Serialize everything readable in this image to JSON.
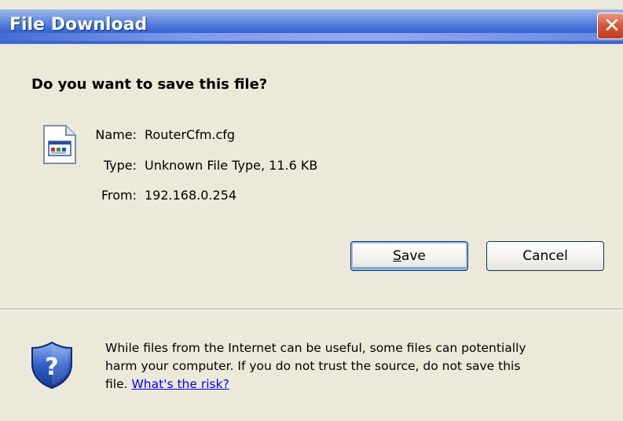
{
  "window": {
    "title": "File Download",
    "close_glyph": "✕"
  },
  "dialog": {
    "question": "Do you want to save this file?",
    "file": {
      "icon": "config-file-icon",
      "name_label": "Name:",
      "name_value": "RouterCfm.cfg",
      "type_label": "Type:",
      "type_value": "Unknown File Type, 11.6 KB",
      "from_label": "From:",
      "from_value": "192.168.0.254"
    },
    "buttons": {
      "save_label_accel": "S",
      "save_label_rest": "ave",
      "cancel_label": "Cancel"
    },
    "warning": {
      "icon": "shield-question-icon",
      "line1": "While files from the Internet can be useful, some files can potentially",
      "line2": "harm your computer. If you do not trust the source, do not save this",
      "line3_prefix": "file.",
      "risk_link": "What's the risk?"
    }
  },
  "colors": {
    "titlebar": "#2b5ccf",
    "body": "#ece9d8",
    "link": "#0000ff",
    "close": "#c23a18"
  }
}
